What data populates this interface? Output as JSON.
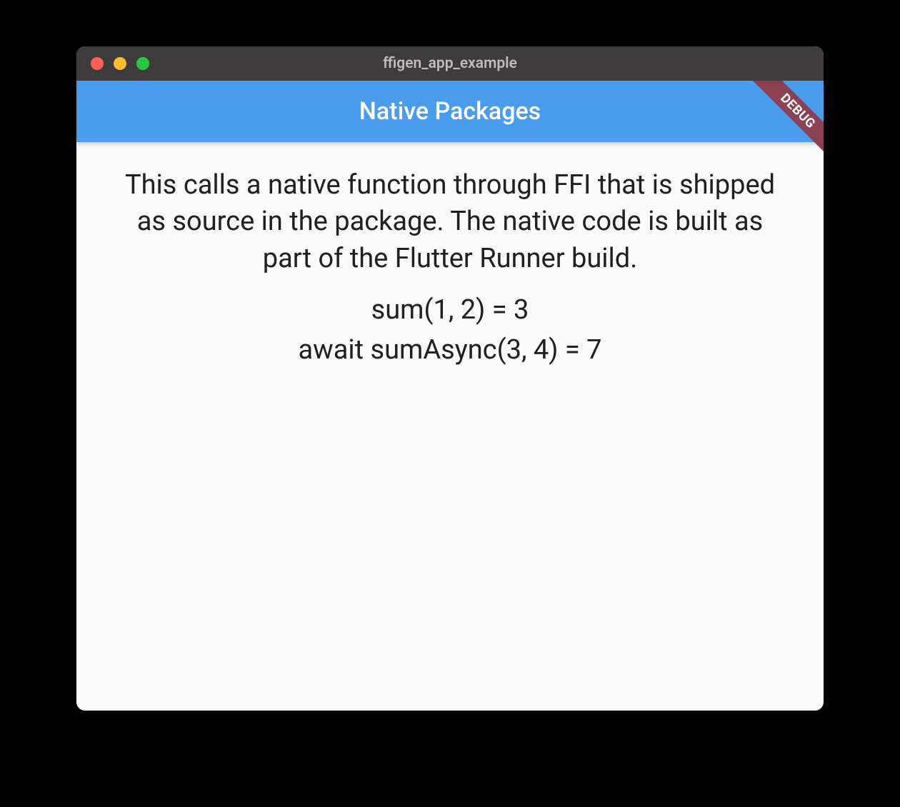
{
  "window": {
    "title": "ffigen_app_example"
  },
  "appbar": {
    "title": "Native Packages",
    "debug_banner": "DEBUG"
  },
  "content": {
    "description": "This calls a native function through FFI that is shipped as source in the package. The native code is built as part of the Flutter Runner build.",
    "sum_result": "sum(1, 2) = 3",
    "sum_async_result": "await sumAsync(3, 4) = 7"
  },
  "colors": {
    "appbar_bg": "#4a9cec",
    "titlebar_bg": "#3d3b3c",
    "debug_banner_bg": "#8c4152",
    "traffic_red": "#ff5f57",
    "traffic_yellow": "#febc2e",
    "traffic_green": "#28c840"
  }
}
